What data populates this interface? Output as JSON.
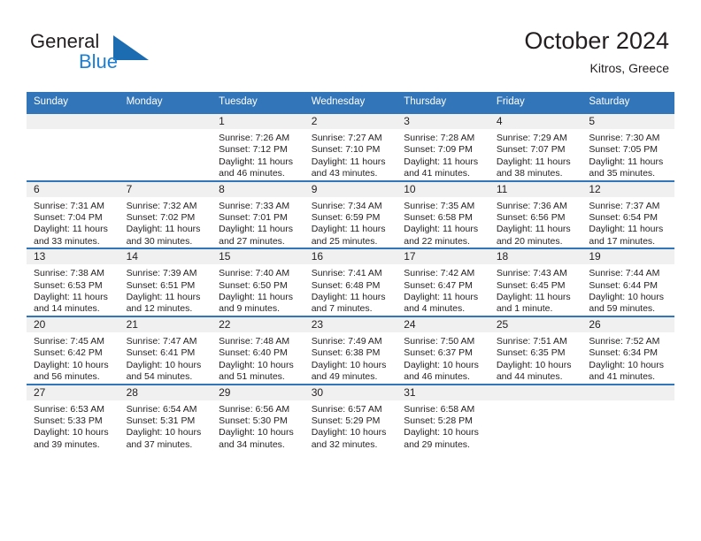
{
  "brand": {
    "name_part1": "General",
    "name_part2": "Blue",
    "logo_icon": "triangle-logo-icon",
    "accent_color": "#1b7fd4"
  },
  "header": {
    "title": "October 2024",
    "subtitle": "Kitros, Greece",
    "header_bg_color": "#3275b8",
    "daynum_bg_color": "#f0f0f0"
  },
  "weekday_headers": [
    "Sunday",
    "Monday",
    "Tuesday",
    "Wednesday",
    "Thursday",
    "Friday",
    "Saturday"
  ],
  "weeks": [
    [
      {
        "day": "",
        "sunrise": "",
        "sunset": "",
        "daylight_line1": "",
        "daylight_line2": ""
      },
      {
        "day": "",
        "sunrise": "",
        "sunset": "",
        "daylight_line1": "",
        "daylight_line2": ""
      },
      {
        "day": "1",
        "sunrise": "Sunrise: 7:26 AM",
        "sunset": "Sunset: 7:12 PM",
        "daylight_line1": "Daylight: 11 hours",
        "daylight_line2": "and 46 minutes."
      },
      {
        "day": "2",
        "sunrise": "Sunrise: 7:27 AM",
        "sunset": "Sunset: 7:10 PM",
        "daylight_line1": "Daylight: 11 hours",
        "daylight_line2": "and 43 minutes."
      },
      {
        "day": "3",
        "sunrise": "Sunrise: 7:28 AM",
        "sunset": "Sunset: 7:09 PM",
        "daylight_line1": "Daylight: 11 hours",
        "daylight_line2": "and 41 minutes."
      },
      {
        "day": "4",
        "sunrise": "Sunrise: 7:29 AM",
        "sunset": "Sunset: 7:07 PM",
        "daylight_line1": "Daylight: 11 hours",
        "daylight_line2": "and 38 minutes."
      },
      {
        "day": "5",
        "sunrise": "Sunrise: 7:30 AM",
        "sunset": "Sunset: 7:05 PM",
        "daylight_line1": "Daylight: 11 hours",
        "daylight_line2": "and 35 minutes."
      }
    ],
    [
      {
        "day": "6",
        "sunrise": "Sunrise: 7:31 AM",
        "sunset": "Sunset: 7:04 PM",
        "daylight_line1": "Daylight: 11 hours",
        "daylight_line2": "and 33 minutes."
      },
      {
        "day": "7",
        "sunrise": "Sunrise: 7:32 AM",
        "sunset": "Sunset: 7:02 PM",
        "daylight_line1": "Daylight: 11 hours",
        "daylight_line2": "and 30 minutes."
      },
      {
        "day": "8",
        "sunrise": "Sunrise: 7:33 AM",
        "sunset": "Sunset: 7:01 PM",
        "daylight_line1": "Daylight: 11 hours",
        "daylight_line2": "and 27 minutes."
      },
      {
        "day": "9",
        "sunrise": "Sunrise: 7:34 AM",
        "sunset": "Sunset: 6:59 PM",
        "daylight_line1": "Daylight: 11 hours",
        "daylight_line2": "and 25 minutes."
      },
      {
        "day": "10",
        "sunrise": "Sunrise: 7:35 AM",
        "sunset": "Sunset: 6:58 PM",
        "daylight_line1": "Daylight: 11 hours",
        "daylight_line2": "and 22 minutes."
      },
      {
        "day": "11",
        "sunrise": "Sunrise: 7:36 AM",
        "sunset": "Sunset: 6:56 PM",
        "daylight_line1": "Daylight: 11 hours",
        "daylight_line2": "and 20 minutes."
      },
      {
        "day": "12",
        "sunrise": "Sunrise: 7:37 AM",
        "sunset": "Sunset: 6:54 PM",
        "daylight_line1": "Daylight: 11 hours",
        "daylight_line2": "and 17 minutes."
      }
    ],
    [
      {
        "day": "13",
        "sunrise": "Sunrise: 7:38 AM",
        "sunset": "Sunset: 6:53 PM",
        "daylight_line1": "Daylight: 11 hours",
        "daylight_line2": "and 14 minutes."
      },
      {
        "day": "14",
        "sunrise": "Sunrise: 7:39 AM",
        "sunset": "Sunset: 6:51 PM",
        "daylight_line1": "Daylight: 11 hours",
        "daylight_line2": "and 12 minutes."
      },
      {
        "day": "15",
        "sunrise": "Sunrise: 7:40 AM",
        "sunset": "Sunset: 6:50 PM",
        "daylight_line1": "Daylight: 11 hours",
        "daylight_line2": "and 9 minutes."
      },
      {
        "day": "16",
        "sunrise": "Sunrise: 7:41 AM",
        "sunset": "Sunset: 6:48 PM",
        "daylight_line1": "Daylight: 11 hours",
        "daylight_line2": "and 7 minutes."
      },
      {
        "day": "17",
        "sunrise": "Sunrise: 7:42 AM",
        "sunset": "Sunset: 6:47 PM",
        "daylight_line1": "Daylight: 11 hours",
        "daylight_line2": "and 4 minutes."
      },
      {
        "day": "18",
        "sunrise": "Sunrise: 7:43 AM",
        "sunset": "Sunset: 6:45 PM",
        "daylight_line1": "Daylight: 11 hours",
        "daylight_line2": "and 1 minute."
      },
      {
        "day": "19",
        "sunrise": "Sunrise: 7:44 AM",
        "sunset": "Sunset: 6:44 PM",
        "daylight_line1": "Daylight: 10 hours",
        "daylight_line2": "and 59 minutes."
      }
    ],
    [
      {
        "day": "20",
        "sunrise": "Sunrise: 7:45 AM",
        "sunset": "Sunset: 6:42 PM",
        "daylight_line1": "Daylight: 10 hours",
        "daylight_line2": "and 56 minutes."
      },
      {
        "day": "21",
        "sunrise": "Sunrise: 7:47 AM",
        "sunset": "Sunset: 6:41 PM",
        "daylight_line1": "Daylight: 10 hours",
        "daylight_line2": "and 54 minutes."
      },
      {
        "day": "22",
        "sunrise": "Sunrise: 7:48 AM",
        "sunset": "Sunset: 6:40 PM",
        "daylight_line1": "Daylight: 10 hours",
        "daylight_line2": "and 51 minutes."
      },
      {
        "day": "23",
        "sunrise": "Sunrise: 7:49 AM",
        "sunset": "Sunset: 6:38 PM",
        "daylight_line1": "Daylight: 10 hours",
        "daylight_line2": "and 49 minutes."
      },
      {
        "day": "24",
        "sunrise": "Sunrise: 7:50 AM",
        "sunset": "Sunset: 6:37 PM",
        "daylight_line1": "Daylight: 10 hours",
        "daylight_line2": "and 46 minutes."
      },
      {
        "day": "25",
        "sunrise": "Sunrise: 7:51 AM",
        "sunset": "Sunset: 6:35 PM",
        "daylight_line1": "Daylight: 10 hours",
        "daylight_line2": "and 44 minutes."
      },
      {
        "day": "26",
        "sunrise": "Sunrise: 7:52 AM",
        "sunset": "Sunset: 6:34 PM",
        "daylight_line1": "Daylight: 10 hours",
        "daylight_line2": "and 41 minutes."
      }
    ],
    [
      {
        "day": "27",
        "sunrise": "Sunrise: 6:53 AM",
        "sunset": "Sunset: 5:33 PM",
        "daylight_line1": "Daylight: 10 hours",
        "daylight_line2": "and 39 minutes."
      },
      {
        "day": "28",
        "sunrise": "Sunrise: 6:54 AM",
        "sunset": "Sunset: 5:31 PM",
        "daylight_line1": "Daylight: 10 hours",
        "daylight_line2": "and 37 minutes."
      },
      {
        "day": "29",
        "sunrise": "Sunrise: 6:56 AM",
        "sunset": "Sunset: 5:30 PM",
        "daylight_line1": "Daylight: 10 hours",
        "daylight_line2": "and 34 minutes."
      },
      {
        "day": "30",
        "sunrise": "Sunrise: 6:57 AM",
        "sunset": "Sunset: 5:29 PM",
        "daylight_line1": "Daylight: 10 hours",
        "daylight_line2": "and 32 minutes."
      },
      {
        "day": "31",
        "sunrise": "Sunrise: 6:58 AM",
        "sunset": "Sunset: 5:28 PM",
        "daylight_line1": "Daylight: 10 hours",
        "daylight_line2": "and 29 minutes."
      },
      {
        "day": "",
        "sunrise": "",
        "sunset": "",
        "daylight_line1": "",
        "daylight_line2": ""
      },
      {
        "day": "",
        "sunrise": "",
        "sunset": "",
        "daylight_line1": "",
        "daylight_line2": ""
      }
    ]
  ]
}
